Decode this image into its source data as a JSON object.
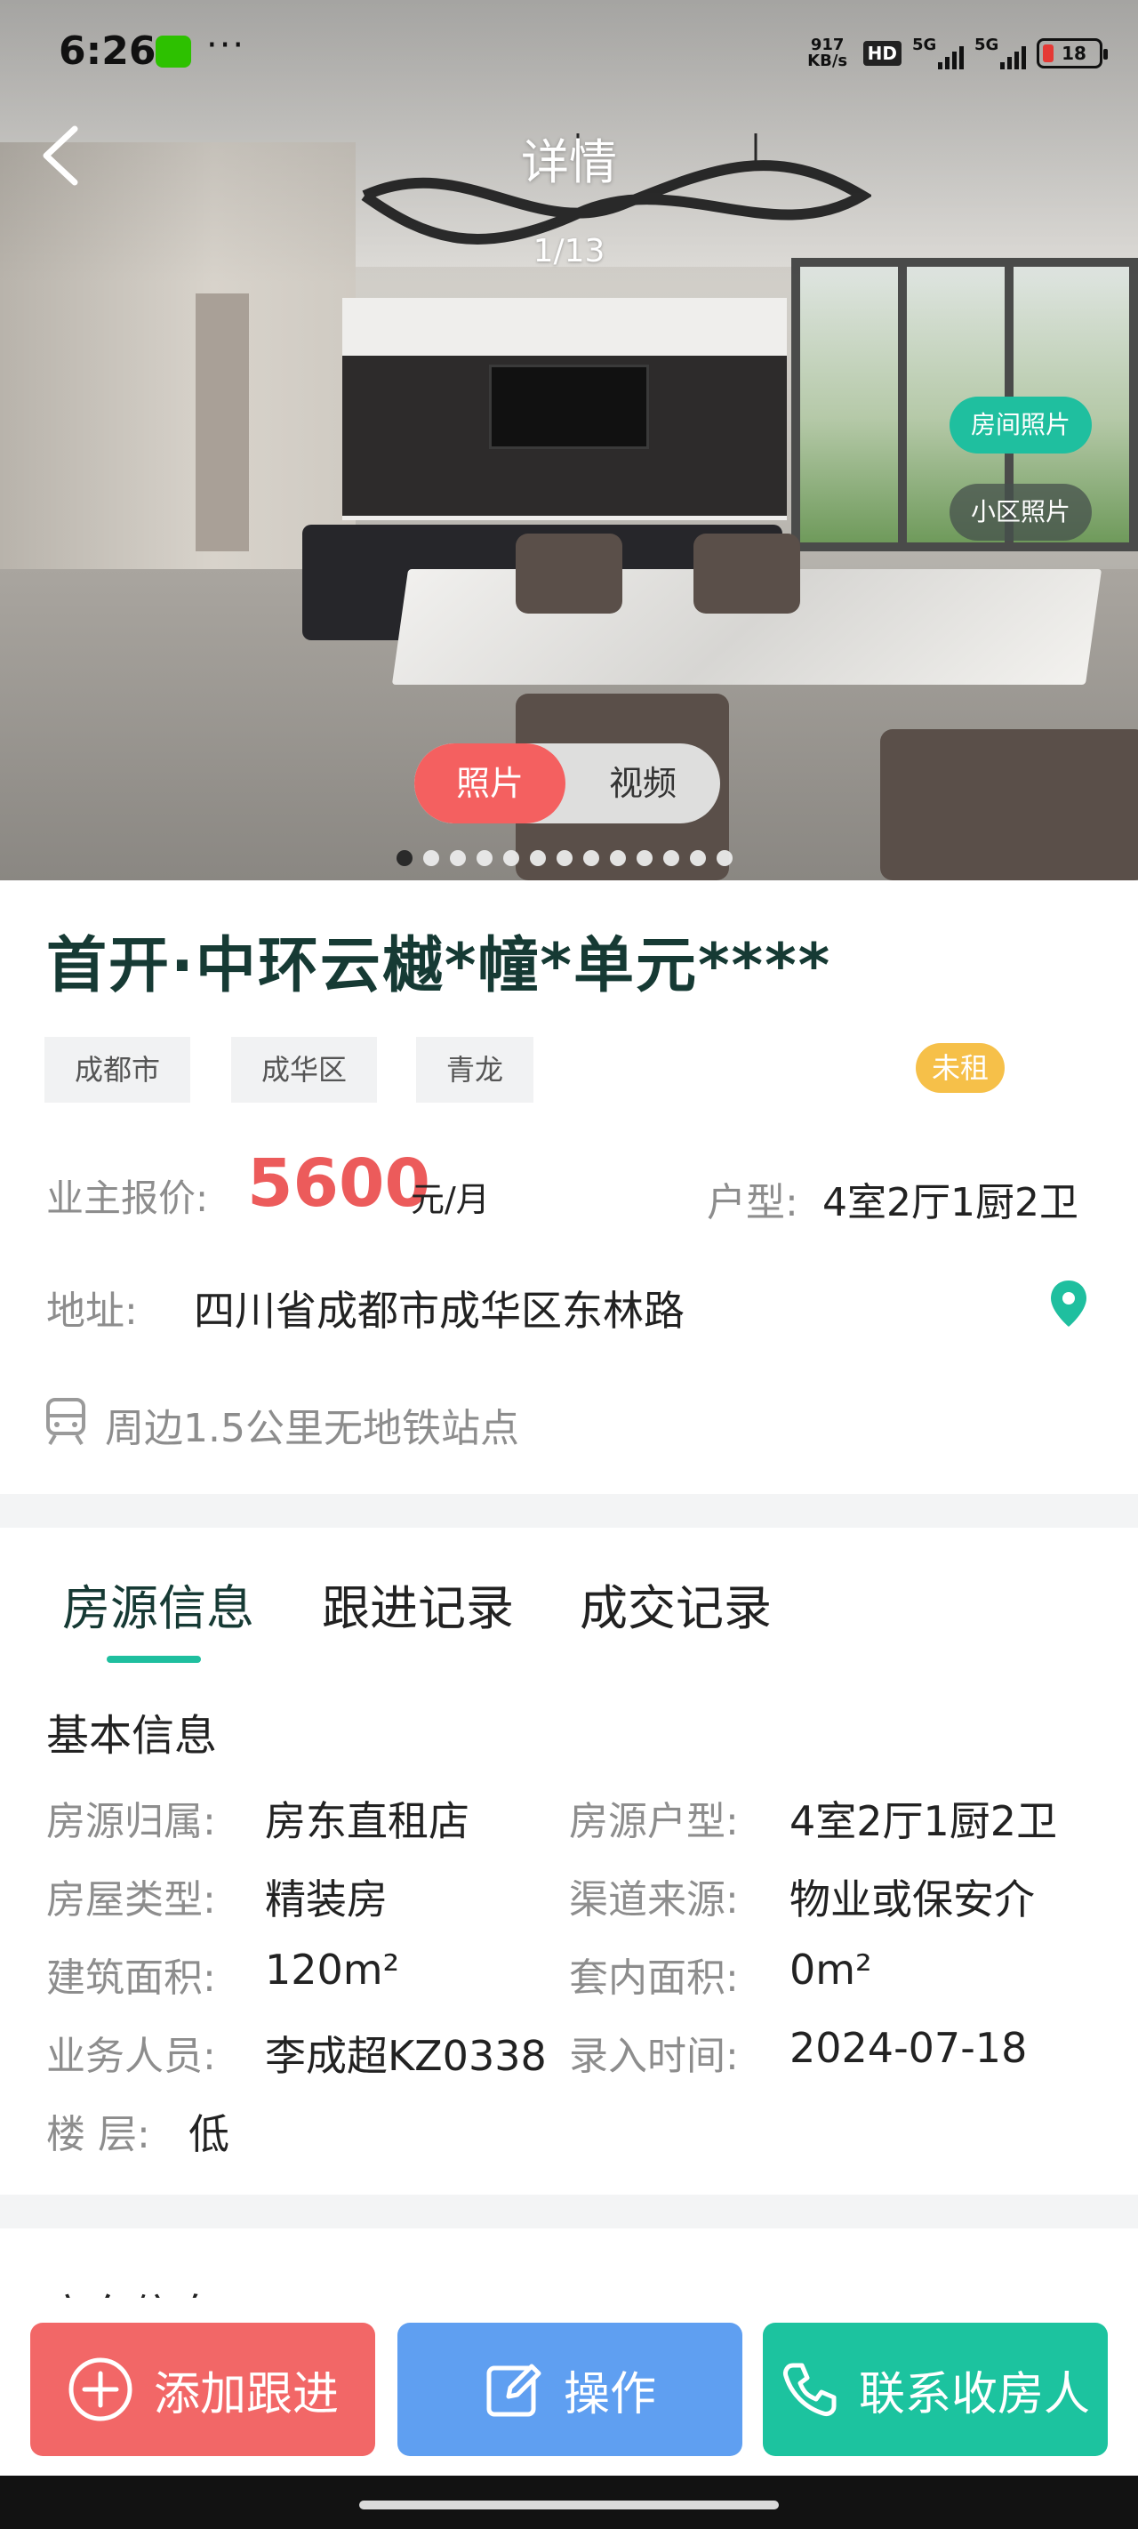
{
  "status_bar": {
    "time": "6:26",
    "dots": "···",
    "net_speed_top": "917",
    "net_speed_bottom": "KB/s",
    "hd_label": "HD",
    "sim1_label": "5G",
    "sim2_label": "5G",
    "battery_level": "18",
    "battery_color": "#e53935"
  },
  "header": {
    "title": "详情",
    "photo_counter": "1/13"
  },
  "gallery": {
    "side_tags": [
      "房间照片",
      "小区照片"
    ],
    "toggle": {
      "photo": "照片",
      "video": "视频"
    },
    "total_photos": 13,
    "current_index": 0
  },
  "listing": {
    "title": "首开·中环云樾*幢*单元****",
    "tags": [
      "成都市",
      "成华区",
      "青龙"
    ],
    "status_badge": "未租",
    "price_label": "业主报价:",
    "price_value": "5600",
    "price_unit": "元/月",
    "layout_label": "户型:",
    "layout_value": "4室2厅1厨2卫",
    "address_label": "地址:",
    "address_value": "四川省成都市成华区东林路",
    "metro_text": "周边1.5公里无地铁站点"
  },
  "tabs": {
    "items": [
      "房源信息",
      "跟进记录",
      "成交记录"
    ],
    "active_index": 0
  },
  "basic_info": {
    "section_title": "基本信息",
    "rows": [
      {
        "label": "房源归属:",
        "value": "房东直租店"
      },
      {
        "label": "房源户型:",
        "value": "4室2厅1厨2卫"
      },
      {
        "label": "房屋类型:",
        "value": "精装房"
      },
      {
        "label": "渠道来源:",
        "value": "物业或保安介"
      },
      {
        "label": "建筑面积:",
        "value": "120m²"
      },
      {
        "label": "套内面积:",
        "value": "0m²"
      },
      {
        "label": "业务人员:",
        "value": "李成超KZ0338"
      },
      {
        "label": "录入时间:",
        "value": "2024-07-18"
      },
      {
        "label": "楼 层:",
        "value": "低"
      }
    ]
  },
  "next_section_title": "房东信息",
  "actions": {
    "follow": "添加跟进",
    "operate": "操作",
    "contact": "联系收房人"
  },
  "colors": {
    "accent_green": "#1fbf9f",
    "price_red": "#ec5b5b",
    "follow_red": "#f26767",
    "operate_blue": "#5f9ff1",
    "contact_green": "#1cc39f",
    "badge_yellow": "#f6c049"
  }
}
